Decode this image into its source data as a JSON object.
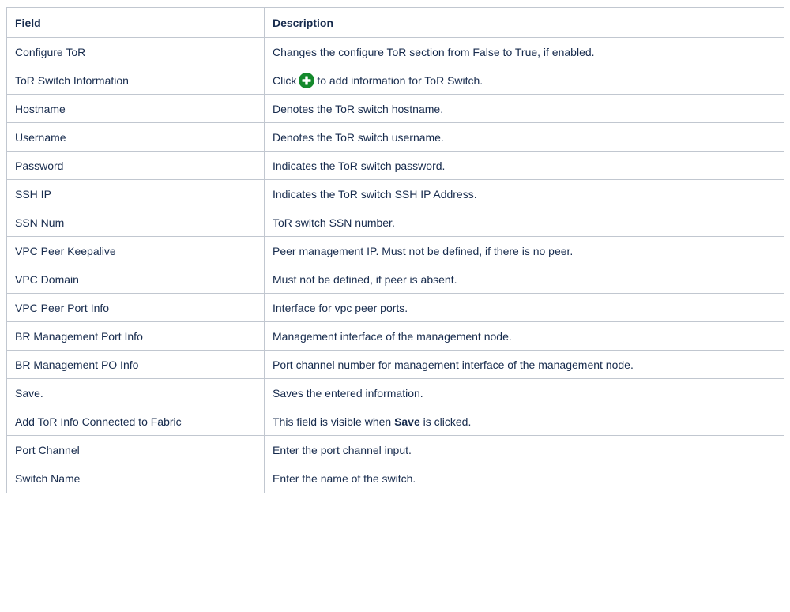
{
  "table": {
    "headers": {
      "field": "Field",
      "description": "Description"
    },
    "rows": [
      {
        "field": "Configure ToR",
        "description": "Changes the configure ToR section from False to True, if enabled."
      },
      {
        "field": "ToR Switch Information",
        "description_before": "Click",
        "description_after": "to add information for ToR Switch.",
        "icon": "plus-circle-icon"
      },
      {
        "field": "Hostname",
        "description": "Denotes the ToR switch hostname."
      },
      {
        "field": "Username",
        "description": "Denotes the ToR switch username."
      },
      {
        "field": "Password",
        "description": "Indicates the ToR switch password."
      },
      {
        "field": "SSH IP",
        "description": "Indicates the ToR switch SSH IP Address."
      },
      {
        "field": "SSN Num",
        "description": "ToR switch SSN number."
      },
      {
        "field": "VPC Peer Keepalive",
        "description": "Peer management IP. Must not be defined, if there is no peer."
      },
      {
        "field": "VPC Domain",
        "description": "Must not be defined, if peer is absent."
      },
      {
        "field": "VPC Peer Port Info",
        "description": "Interface for vpc peer ports."
      },
      {
        "field": "BR Management Port Info",
        "description": "Management interface of the management node."
      },
      {
        "field": "BR Management PO Info",
        "description": "Port channel number for management interface of the management node."
      },
      {
        "field": "Save.",
        "description": "Saves the entered information."
      },
      {
        "field": "Add ToR Info Connected to Fabric",
        "description_before": "This field is visible when",
        "description_bold": "Save",
        "description_after": "is clicked."
      },
      {
        "field": "Port Channel",
        "description": "Enter the port channel input."
      },
      {
        "field": "Switch Name",
        "description": "Enter the name of the switch."
      }
    ]
  },
  "colors": {
    "border": "#c1c7d0",
    "text": "#172b4d",
    "icon_green": "#14892c"
  }
}
